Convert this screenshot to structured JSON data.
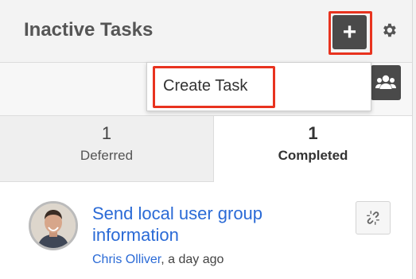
{
  "dashlet": {
    "title": "Inactive Tasks",
    "add_icon": "plus-icon",
    "settings_icon": "gear-icon"
  },
  "create_menu": {
    "items": [
      {
        "label": "Create Task"
      }
    ]
  },
  "toolbar": {
    "group_icon": "users-icon"
  },
  "tabs": [
    {
      "count": "1",
      "label": "Deferred",
      "active": false
    },
    {
      "count": "1",
      "label": "Completed",
      "active": true
    }
  ],
  "tasks": [
    {
      "title": "Send local user group information",
      "author": "Chris Olliver",
      "time": ", a day ago",
      "action_icon": "unlink-icon"
    }
  ],
  "colors": {
    "highlight": "#e8331f",
    "link": "#2a6ad6",
    "button_dark": "#4a4a4a"
  }
}
